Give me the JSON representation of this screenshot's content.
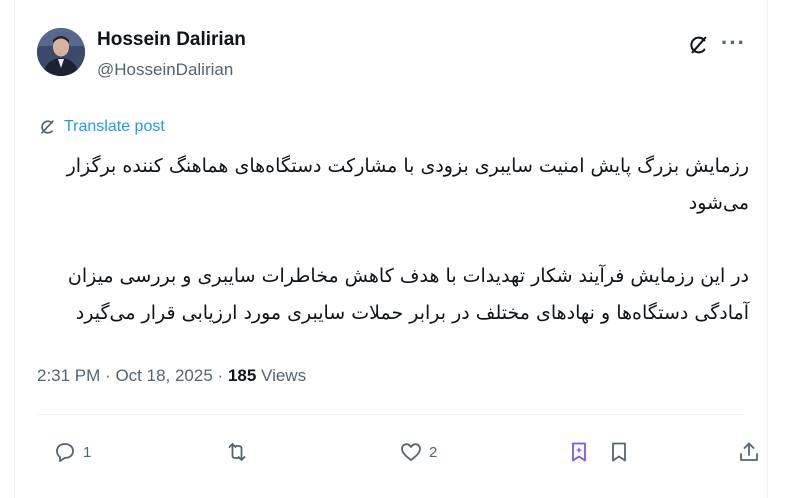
{
  "author": {
    "name": "Hossein Dalirian",
    "handle": "@HosseinDalirian"
  },
  "header_icons": [
    "grok-icon",
    "more-icon"
  ],
  "more_label": "···",
  "translate": {
    "label": "Translate post",
    "icon": "translate-icon"
  },
  "post": {
    "paragraph1": "رزمایش بزرگ پایش امنیت سایبری بزودی با مشارکت دستگاه‌های هماهنگ کننده برگزار می‌شود",
    "paragraph2": "در این رزمایش فرآیند شکار تهدیدات با هدف کاهش مخاطرات سایبری و بررسی میزان آمادگی دستگاه‌ها و نهادهای مختلف در برابر حملات سایبری مورد ارزیابی قرار می‌گیرد"
  },
  "meta": {
    "time": "2:31 PM",
    "date": "Oct 18, 2025",
    "separator": "·",
    "views_count": "185",
    "views_label": "Views"
  },
  "actions": {
    "reply_count": "1",
    "repost_count": "",
    "like_count": "2"
  },
  "colors": {
    "accent": "#1d9bf0",
    "secondary_text": "#536471",
    "primary_text": "#0f1419",
    "grok_bookmark": "#7856ff"
  }
}
